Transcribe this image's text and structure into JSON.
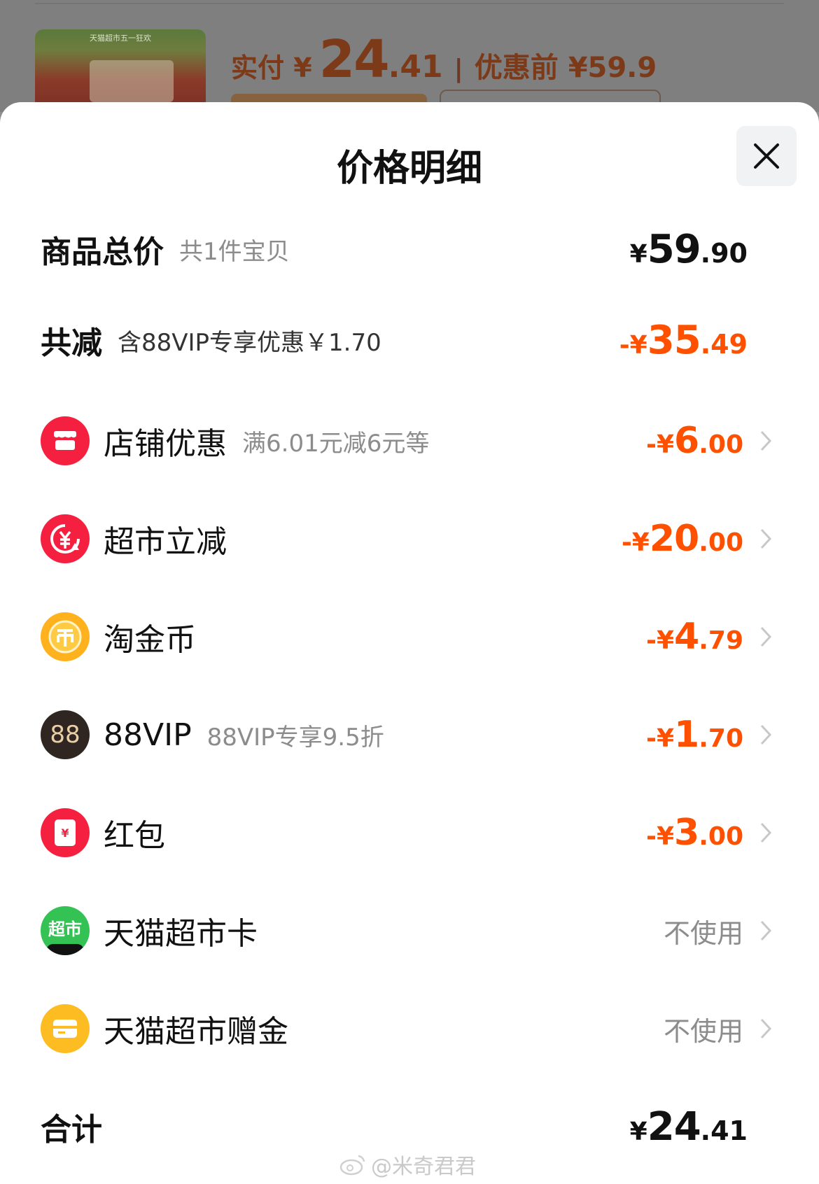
{
  "backdrop": {
    "thumb_caption": "天猫超市五一狂欢",
    "paid_label": "实付 ¥",
    "paid_int": "24",
    "paid_dec": ".41",
    "separator": "|",
    "original_price": "优惠前 ¥59.9"
  },
  "sheet": {
    "title": "价格明细",
    "close_icon": "close-icon"
  },
  "summary": {
    "total": {
      "label": "商品总价",
      "sub": "共1件宝贝",
      "sym": "¥",
      "int": "59",
      "dec": ".90"
    },
    "discount": {
      "label": "共减",
      "sub": "含88VIP专享优惠￥1.70",
      "sym": "-¥",
      "int": "35",
      "dec": ".49"
    }
  },
  "items": [
    {
      "icon": "shop-icon",
      "label": "店铺优惠",
      "sub": "满6.01元减6元等",
      "sym": "-¥",
      "int": "6",
      "dec": ".00",
      "color": "#f5203f"
    },
    {
      "icon": "yuan-down-icon",
      "label": "超市立减",
      "sub": "",
      "sym": "-¥",
      "int": "20",
      "dec": ".00",
      "color": "#f5203f"
    },
    {
      "icon": "coin-icon",
      "label": "淘金币",
      "sub": "",
      "sym": "-¥",
      "int": "4",
      "dec": ".79",
      "color": "#ffb21e"
    },
    {
      "icon": "vip88-icon",
      "label": "88VIP",
      "sub": "88VIP专享9.5折",
      "sym": "-¥",
      "int": "1",
      "dec": ".70",
      "color": "#2f2622"
    },
    {
      "icon": "red-envelope-icon",
      "label": "红包",
      "sub": "",
      "sym": "-¥",
      "int": "3",
      "dec": ".00",
      "color": "#f5203f"
    },
    {
      "icon": "supermarket-card-icon",
      "label": "天猫超市卡",
      "sub": "",
      "value": "不使用",
      "color": "#34c255"
    },
    {
      "icon": "gift-money-icon",
      "label": "天猫超市赠金",
      "sub": "",
      "value": "不使用",
      "color": "#fdbd22"
    }
  ],
  "grand_total": {
    "label": "合计",
    "sym": "¥",
    "int": "24",
    "dec": ".41"
  },
  "watermark": "@米奇君君",
  "icon_glyphs": {
    "card": "超市",
    "envelope": "¥",
    "vip": "88"
  },
  "colors": {
    "accent": "#ff5000",
    "text": "#111111",
    "muted": "#8c8c8c"
  }
}
